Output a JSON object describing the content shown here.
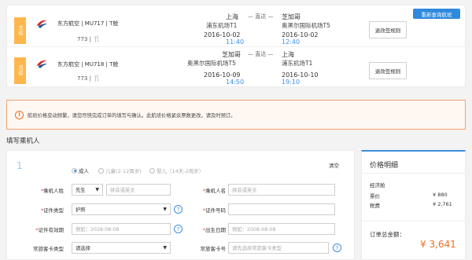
{
  "flight_card": {
    "requery_label": "重新查询航班",
    "segments": [
      {
        "tag": "去程",
        "airline": "东方航空 | MU717 | T舱",
        "aircraft": "773 |",
        "from_city": "上海",
        "from_airport": "浦东机场T1",
        "direct": "— 直达 —",
        "to_city": "芝加哥",
        "to_airport": "奥黑尔国际机场T5",
        "dep_date": "2016-10-02",
        "dep_time": "11:40",
        "arr_date": "2016-10-02",
        "arr_time": "12:40",
        "change_label": "退改签规则"
      },
      {
        "tag": "回程",
        "airline": "东方航空 | MU718 | T舱",
        "aircraft": "773 |",
        "from_city": "芝加哥",
        "from_airport": "奥黑尔国际机场T5",
        "direct": "— 直达 —",
        "to_city": "上海",
        "to_airport": "浦东机场T1",
        "dep_date": "2016-10-09",
        "dep_time": "14:50",
        "arr_date": "2016-10-10",
        "arr_time": "19:10",
        "change_label": "退改签规则"
      }
    ],
    "brand_color": "#2f89dc",
    "meal_icon": "fork-knife-icon"
  },
  "alert": {
    "icon": "exclamation-icon",
    "text": "航班价格变动频繁，请您尽快完成订单的填写与确认。此航班价格紧余票数更改，请及时预订。"
  },
  "passenger": {
    "section_title": "填写乘机人",
    "index": "1",
    "types": [
      {
        "label": "成人",
        "checked": true
      },
      {
        "label": "儿童(2-12周岁)",
        "checked": false
      },
      {
        "label": "婴儿（14天-2周岁）",
        "checked": false
      }
    ],
    "clear_label": "清空",
    "fields": {
      "last_name_label": "乘机人姓",
      "title_value": "先生",
      "last_name_placeholder": "拼音或英文",
      "first_name_label": "乘机人名",
      "first_name_placeholder": "拼音或英文",
      "id_type_label": "证件类型",
      "id_type_value": "护照",
      "id_no_label": "证件号码",
      "id_no_value": "",
      "expiry_label": "证件有效期",
      "expiry_placeholder": "例如：2028-08-08",
      "birth_label": "出生日期",
      "birth_placeholder": "例如：2008-08-08",
      "ff_type_label": "常旅客卡类型",
      "ff_type_value": "请选择",
      "ff_no_label": "常旅客卡号",
      "ff_no_placeholder": "请先选择常旅客卡类型"
    }
  },
  "price": {
    "title": "价格明细",
    "cabin": "经济舱",
    "ticket_label": "票价",
    "ticket_value": "¥ 880",
    "tax_label": "税费",
    "tax_value": "¥ 2,761",
    "total_label": "订单总金额：",
    "total_value": "¥ 3,641",
    "accent_color": "#f07020"
  }
}
